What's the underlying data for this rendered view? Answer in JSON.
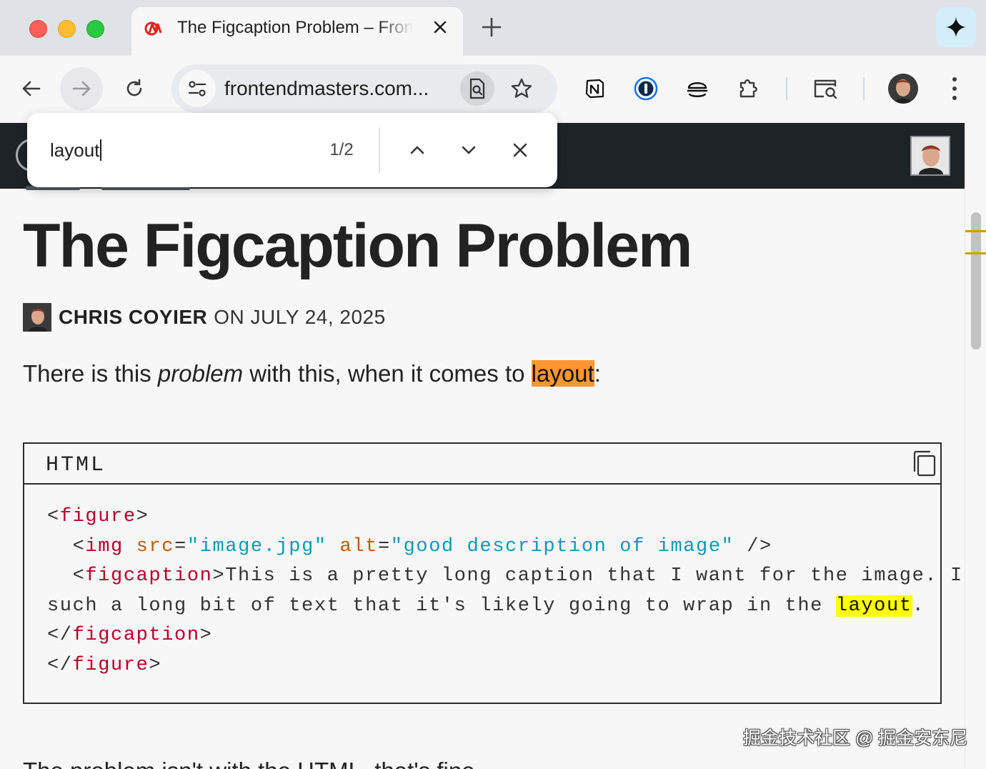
{
  "browser": {
    "tab": {
      "title": "The Figcaption Problem – Frontend Masters Blog",
      "favicon": "frontend-masters-logo"
    },
    "url_display": "frontendmasters.com...",
    "colors": {
      "accent": "#e0241d",
      "tabstrip": "#dfe3e8",
      "gemini_bg": "#d3eef8"
    }
  },
  "find_bar": {
    "query": "layout",
    "count": "1/2"
  },
  "article": {
    "title": "The Figcaption Problem",
    "author": "CHRIS COYIER",
    "date_prefix": "ON JULY 24, 2025",
    "intro": {
      "before": "There is this ",
      "emphasis": "problem",
      "middle": " with this, when it comes to ",
      "match": "layout",
      "after": ":"
    },
    "code_block": {
      "language": "HTML",
      "lines": {
        "l1_open": "<",
        "l1_tag": "figure",
        "l1_close": ">",
        "l2_indent": "  <",
        "l2_tag": "img",
        "l2_attr1": "src",
        "l2_eq1": "=",
        "l2_val1": "\"image.jpg\"",
        "l2_attr2": "alt",
        "l2_eq2": "=",
        "l2_val2": "\"good description of image\"",
        "l2_end": " />",
        "l3_indent": "  <",
        "l3_tag": "figcaption",
        "l3_text": ">This is a pretty long caption that I want for the image. It's",
        "l4_text": "such a long bit of text that it's likely going to wrap in the ",
        "l4_match": "layout",
        "l4_end": ".",
        "l5_open": "</",
        "l5_tag": "figcaption",
        "l5_close": ">",
        "l6_open": "</",
        "l6_tag": "figure",
        "l6_close": ">"
      }
    },
    "next_paragraph": "The problem isn't with the HTML, that's fine."
  },
  "watermark": "掘金技术社区 @ 掘金安东尼"
}
